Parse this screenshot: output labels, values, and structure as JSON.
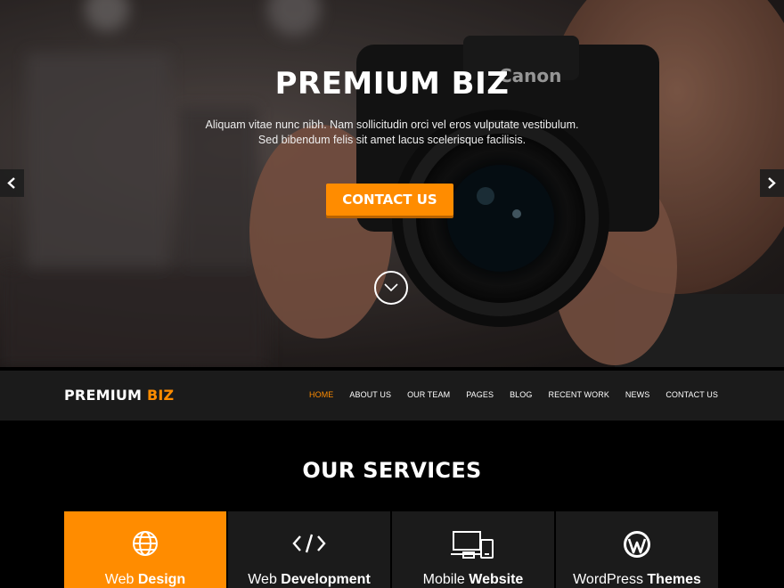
{
  "hero": {
    "title": "PREMIUM BIZ",
    "text_line1": "Aliquam vitae nunc nibh. Nam sollicitudin orci vel eros vulputate vestibulum.",
    "text_line2": "Sed bibendum felis sit amet lacus scelerisque facilisis.",
    "cta_label": "CONTACT US",
    "camera_brand": "Canon",
    "icons": {
      "prev": "chevron-left-icon",
      "next": "chevron-right-icon",
      "scroll": "chevron-down-icon"
    }
  },
  "nav": {
    "logo_part1": "PREMIUM",
    "logo_part2": "BIZ",
    "items": [
      {
        "label": "HOME",
        "active": true
      },
      {
        "label": "ABOUT US"
      },
      {
        "label": "OUR TEAM"
      },
      {
        "label": "PAGES"
      },
      {
        "label": "BLOG"
      },
      {
        "label": "RECENT WORK"
      },
      {
        "label": "NEWS"
      },
      {
        "label": "CONTACT US"
      }
    ]
  },
  "services": {
    "title": "OUR SERVICES",
    "cards": [
      {
        "light": "Web",
        "bold": "Design",
        "icon": "globe-icon",
        "active": true
      },
      {
        "light": "Web",
        "bold": "Development",
        "icon": "code-icon"
      },
      {
        "light": "Mobile",
        "bold": "Website",
        "icon": "devices-icon"
      },
      {
        "light": "WordPress",
        "bold": "Themes",
        "icon": "wordpress-icon"
      }
    ]
  },
  "colors": {
    "accent": "#ff8c00",
    "nav_bg": "#1b1b1b",
    "page_bg": "#000000"
  }
}
